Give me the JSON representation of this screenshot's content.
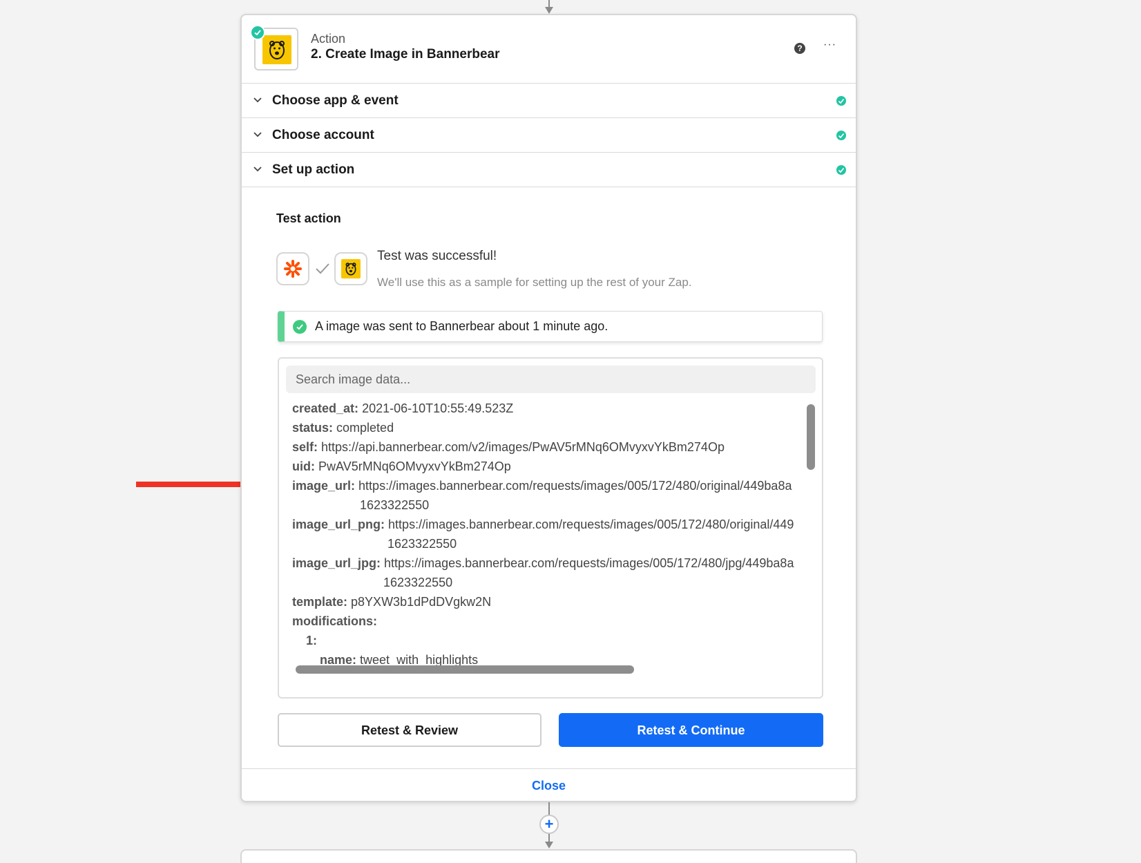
{
  "step": {
    "kicker": "Action",
    "title": "2. Create Image in Bannerbear",
    "help_glyph": "?",
    "more_glyph": "···"
  },
  "sections": [
    {
      "label": "Choose app & event"
    },
    {
      "label": "Choose account"
    },
    {
      "label": "Set up action"
    }
  ],
  "test": {
    "section_title": "Test action",
    "result_title": "Test was successful!",
    "result_subtitle": "We'll use this as a sample for setting up the rest of your Zap.",
    "notice": "A image was sent to Bannerbear about 1 minute ago."
  },
  "search": {
    "placeholder": "Search image data..."
  },
  "data_lines": [
    {
      "key": "created_at:",
      "value": "2021-06-10T10:55:49.523Z"
    },
    {
      "key": "status:",
      "value": "completed"
    },
    {
      "key": "self:",
      "value": "https://api.bannerbear.com/v2/images/PwAV5rMNq6OMvyxvYkBm274Op"
    },
    {
      "key": "uid:",
      "value": "PwAV5rMNq6OMvyxvYkBm274Op"
    },
    {
      "key": "image_url:",
      "value": "https://images.bannerbear.com/requests/images/005/172/480/original/449ba8a"
    },
    {
      "key": "",
      "value": "1623322550"
    },
    {
      "key": "image_url_png:",
      "value": "https://images.bannerbear.com/requests/images/005/172/480/original/449"
    },
    {
      "key": "",
      "value": "1623322550"
    },
    {
      "key": "image_url_jpg:",
      "value": "https://images.bannerbear.com/requests/images/005/172/480/jpg/449ba8a"
    },
    {
      "key": "",
      "value": "1623322550"
    },
    {
      "key": "template:",
      "value": "p8YXW3b1dPdDVgkw2N"
    },
    {
      "key": "modifications:",
      "value": ""
    },
    {
      "key": "1:",
      "value": ""
    },
    {
      "key": "name:",
      "value": "tweet_with_highlights"
    }
  ],
  "buttons": {
    "retest_review": "Retest & Review",
    "retest_continue": "Retest & Continue"
  },
  "footer": {
    "close": "Close"
  },
  "add_step_glyph": "+",
  "colors": {
    "accent_blue": "#136bf5",
    "success_teal": "#23c4a3",
    "success_green": "#5fd394",
    "bannerbear_yellow": "#f7c600",
    "zapier_orange": "#ff4f00",
    "annotation_red": "#ee3224"
  }
}
